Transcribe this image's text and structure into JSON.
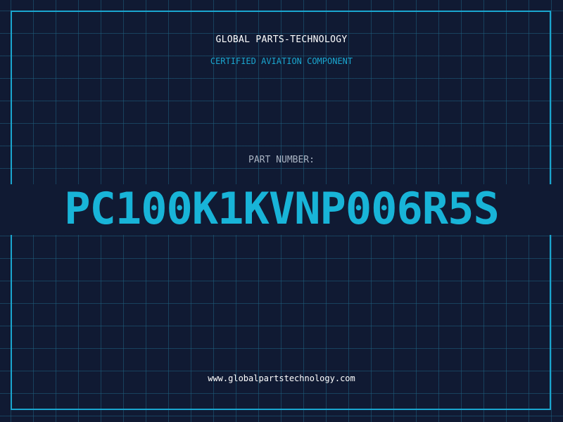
{
  "header": {
    "company_name": "GLOBAL PARTS-TECHNOLOGY",
    "tagline": "CERTIFIED AVIATION COMPONENT"
  },
  "part": {
    "label": "PART NUMBER:",
    "number": "PC100K1KVNP006R5S"
  },
  "footer": {
    "website": "www.globalpartstechnology.com"
  },
  "colors": {
    "background": "#101a33",
    "accent": "#1aa6cf",
    "part_number": "#18b4d8",
    "label": "#a9b3c2",
    "text": "#ffffff"
  }
}
